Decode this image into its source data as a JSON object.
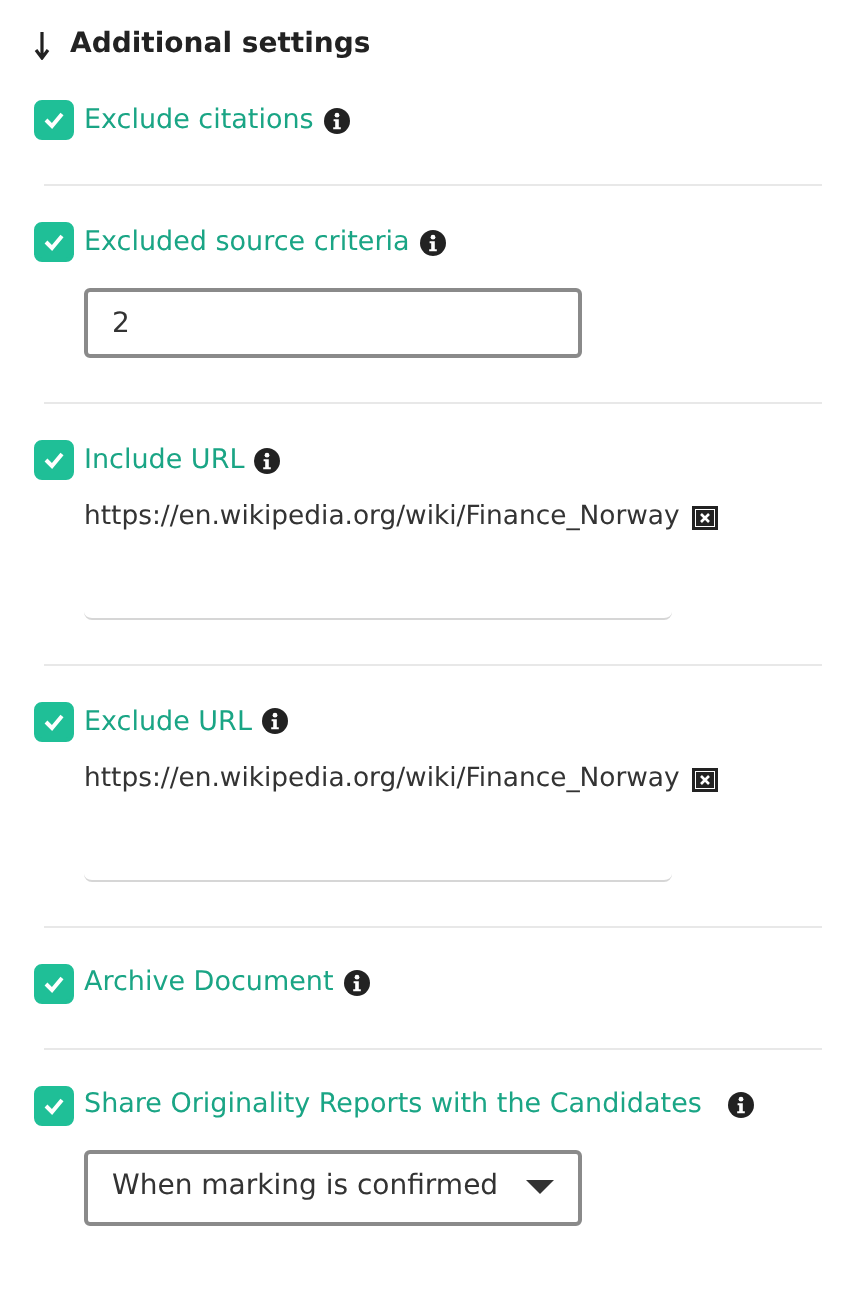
{
  "heading": {
    "title": "Additional settings"
  },
  "settings": [
    {
      "kind": "plain",
      "label": "Exclude citations",
      "checked": true
    },
    {
      "kind": "number",
      "label": "Excluded source criteria",
      "checked": true,
      "value": "2"
    },
    {
      "kind": "url",
      "label": "Include URL",
      "checked": true,
      "url": "https://en.wikipedia.org/wiki/Finance_Norway"
    },
    {
      "kind": "url",
      "label": "Exclude URL",
      "checked": true,
      "url": "https://en.wikipedia.org/wiki/Finance_Norway"
    },
    {
      "kind": "plain",
      "label": "Archive Document",
      "checked": true
    },
    {
      "kind": "select",
      "label": "Share Originality Reports with the Candidates",
      "checked": true,
      "value": "When marking is confirmed"
    }
  ]
}
